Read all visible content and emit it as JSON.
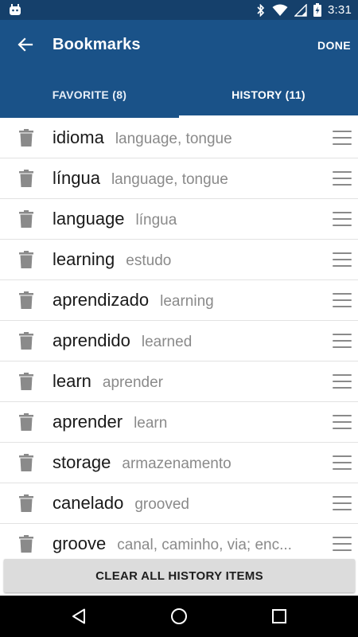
{
  "status_bar": {
    "time": "3:31",
    "battery_level": "charging",
    "icons": [
      "android-icon",
      "bluetooth-icon",
      "wifi-icon",
      "signal-icon",
      "battery-charging-icon"
    ]
  },
  "app_bar": {
    "title": "Bookmarks",
    "done_label": "DONE",
    "back_icon": "arrow-back-icon"
  },
  "tabs": [
    {
      "label": "FAVORITE (8)",
      "active": false
    },
    {
      "label": "HISTORY (11)",
      "active": true
    }
  ],
  "history_items": [
    {
      "word": "idioma",
      "translation": "language, tongue"
    },
    {
      "word": "língua",
      "translation": "language, tongue"
    },
    {
      "word": "language",
      "translation": "língua"
    },
    {
      "word": "learning",
      "translation": "estudo"
    },
    {
      "word": "aprendizado",
      "translation": "learning"
    },
    {
      "word": "aprendido",
      "translation": "learned"
    },
    {
      "word": "learn",
      "translation": "aprender"
    },
    {
      "word": "aprender",
      "translation": "learn"
    },
    {
      "word": "storage",
      "translation": "armazenamento"
    },
    {
      "word": "canelado",
      "translation": "grooved"
    },
    {
      "word": "groove",
      "translation": "canal, caminho, via; enc..."
    }
  ],
  "clear_button_label": "CLEAR ALL HISTORY ITEMS",
  "colors": {
    "status_bar": "#15406b",
    "app_bar": "#1a5288",
    "button_bg": "#dcdcdc",
    "secondary_text": "#8a8a8a"
  }
}
